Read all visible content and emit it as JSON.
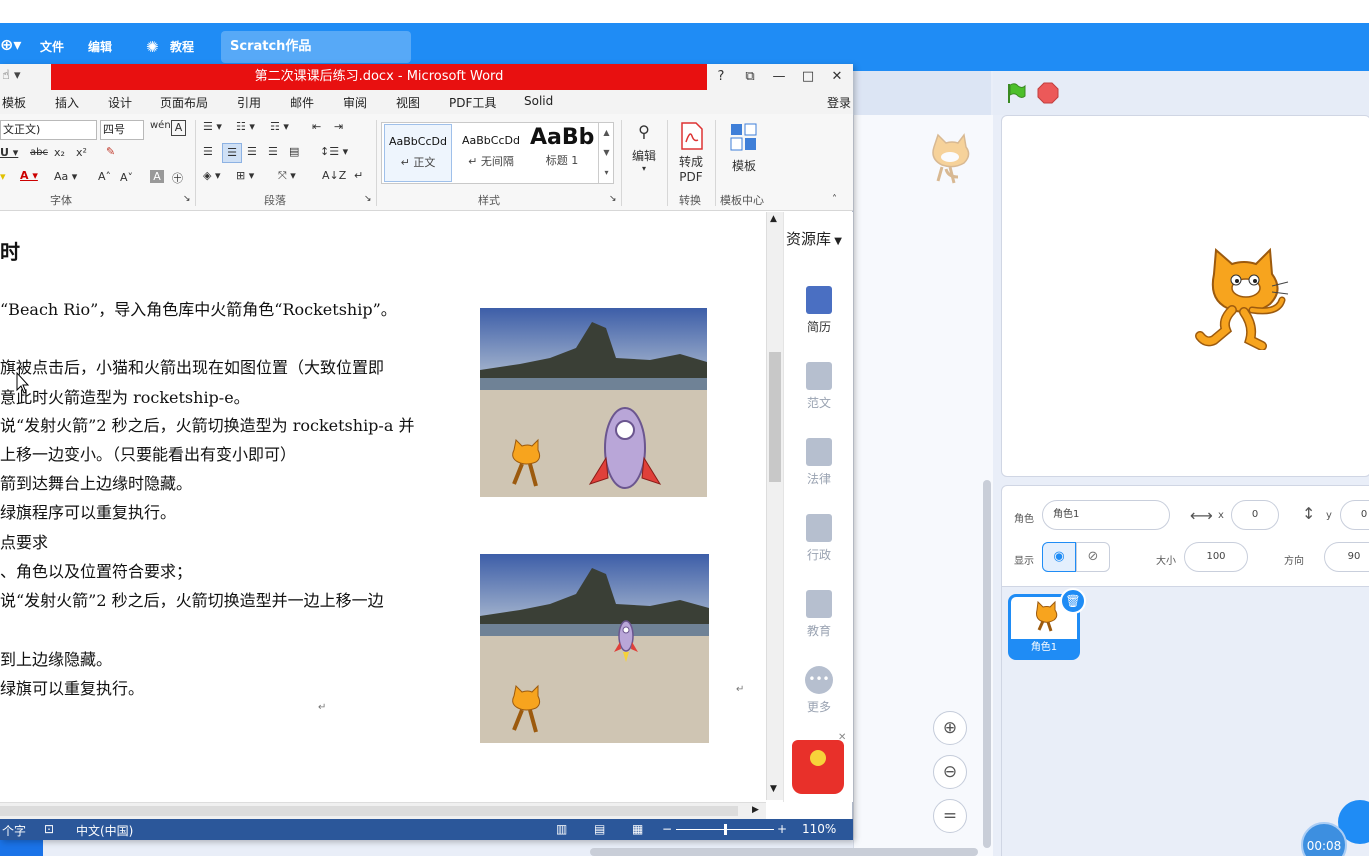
{
  "scratch": {
    "menu": {
      "file": "文件",
      "edit": "编辑",
      "tutorial": "教程",
      "project_title": "Scratch作品"
    },
    "sprite_info": {
      "sprite_label": "角色",
      "sprite_name": "角色1",
      "x_label": "x",
      "x_value": "0",
      "y_label": "y",
      "y_value": "0",
      "show_label": "显示",
      "size_label": "大小",
      "size_value": "100",
      "direction_label": "方向",
      "direction_value": "90"
    },
    "sprite_thumb_label": "角色1",
    "timer": "00:08",
    "zoom": {
      "in": "+",
      "out": "−",
      "reset": "="
    }
  },
  "word": {
    "title": "第二次课课后练习.docx - Microsoft Word",
    "controls": {
      "help": "?",
      "restore": "⧉",
      "minimize": "—",
      "maximize": "□",
      "close": "✕"
    },
    "tabs": [
      "模板",
      "插入",
      "设计",
      "页面布局",
      "引用",
      "邮件",
      "审阅",
      "视图",
      "PDF工具",
      "Solid"
    ],
    "login": "登录",
    "ribbon": {
      "font_name": "文正文)",
      "font_size": "四号",
      "group_font": "字体",
      "group_paragraph": "段落",
      "group_styles": "样式",
      "group_convert": "转换",
      "group_template_center": "模板中心",
      "styles": [
        {
          "sample": "AaBbCcDd",
          "name": "↵ 正文"
        },
        {
          "sample": "AaBbCcDd",
          "name": "↵ 无间隔"
        },
        {
          "sample": "AaBb",
          "name": "标题 1"
        }
      ],
      "edit_label": "编辑",
      "to_pdf_line1": "转成",
      "to_pdf_line2": "PDF",
      "template_label": "模板"
    },
    "document_lines": [
      "时",
      "“Beach Rio”，导入角色库中火箭角色“Rocketship”。",
      "旗被点击后，小猫和火箭出现在如图位置（大致位置即",
      "意此时火箭造型为 rocketship-e。",
      "说“发射火箭”2 秒之后，火箭切换造型为 rocketship-a 并",
      "上移一边变小。（只要能看出有变小即可）",
      "箭到达舞台上边缘时隐藏。",
      "绿旗程序可以重复执行。",
      "点要求",
      "、角色以及位置符合要求；",
      "说“发射火箭”2 秒之后，火箭切换造型并一边上移一边",
      "到上边缘隐藏。",
      "绿旗可以重复执行。"
    ],
    "side_panel": {
      "header": "资源库",
      "items": [
        "简历",
        "范文",
        "法律",
        "行政",
        "教育",
        "更多"
      ]
    },
    "status": {
      "word_count": "个字",
      "language": "中文(中国)",
      "zoom": "110%"
    }
  }
}
